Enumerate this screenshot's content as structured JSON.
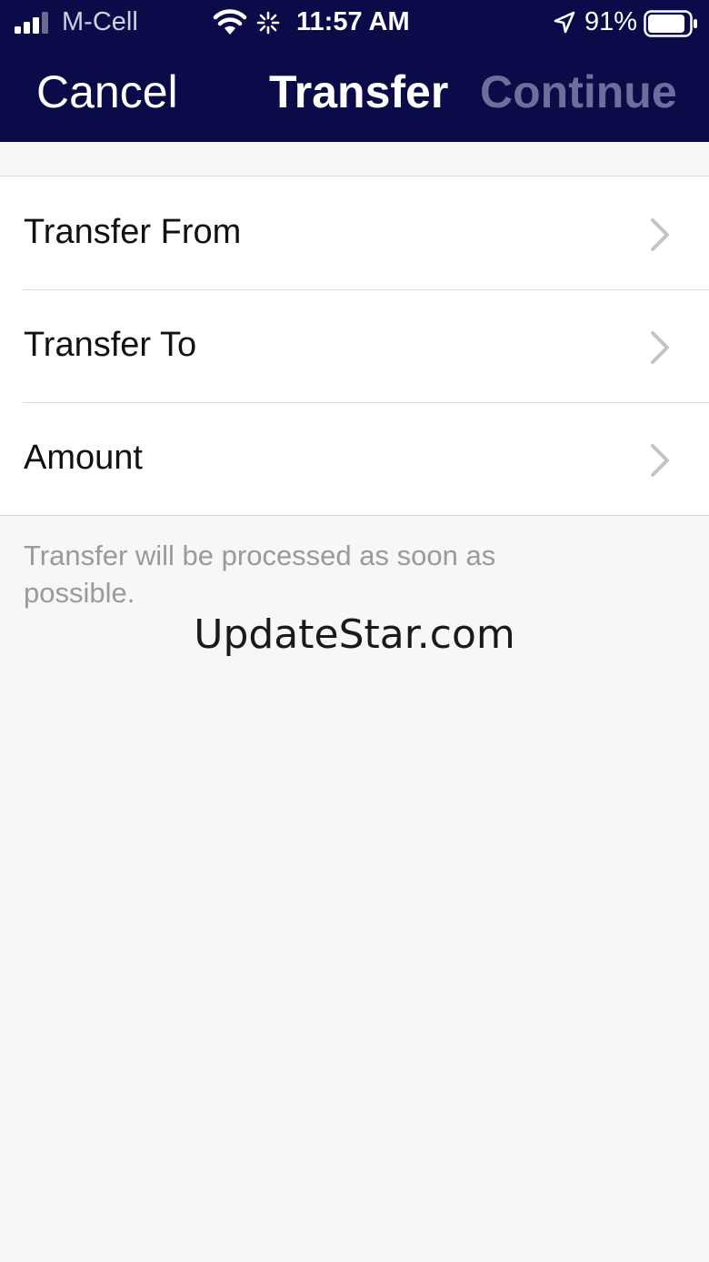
{
  "status_bar": {
    "carrier": "M-Cell",
    "time": "11:57 AM",
    "battery": "91%",
    "battery_level": 0.91,
    "signal_bars": 3,
    "signal_bars_total": 4
  },
  "nav": {
    "cancel_label": "Cancel",
    "title": "Transfer",
    "continue_label": "Continue"
  },
  "form": {
    "rows": [
      {
        "label": "Transfer From",
        "icon": "chevron-right-icon"
      },
      {
        "label": "Transfer To",
        "icon": "chevron-right-icon"
      },
      {
        "label": "Amount",
        "icon": "chevron-right-icon"
      }
    ]
  },
  "footnote": "Transfer will be processed as soon as possible.",
  "watermark": "UpdateStar.com",
  "colors": {
    "nav_background": "#0b0b4a",
    "disabled_action": "#6e6e9a",
    "page_background": "#f7f7f7"
  }
}
